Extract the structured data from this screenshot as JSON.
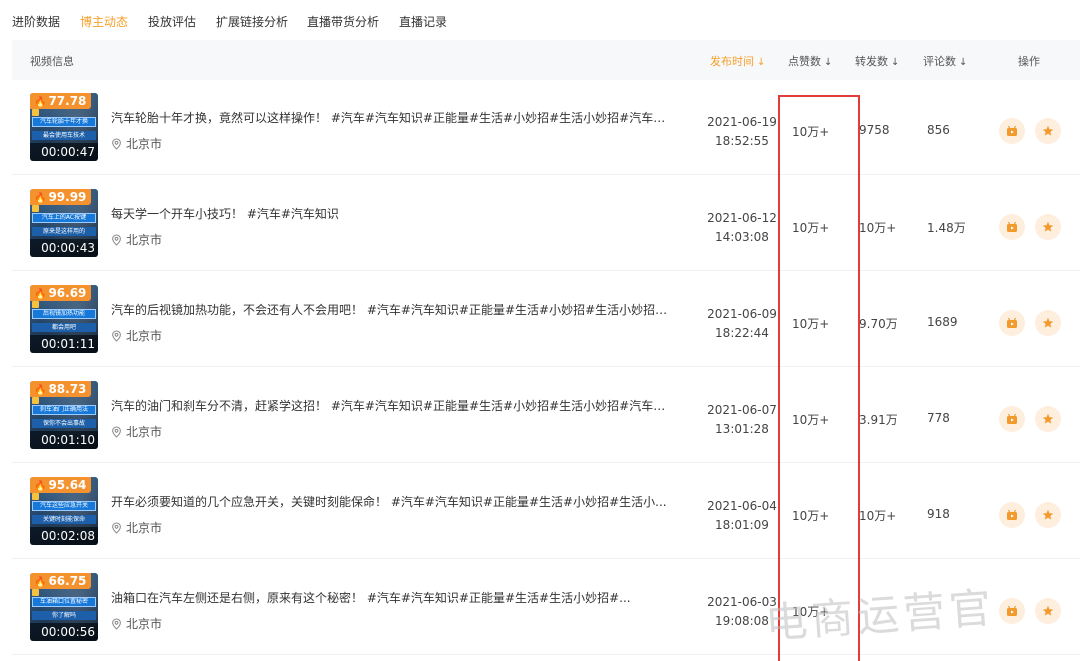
{
  "tabs": [
    "进阶数据",
    "博主动态",
    "投放评估",
    "扩展链接分析",
    "直播带货分析",
    "直播记录"
  ],
  "active_tab": "博主动态",
  "table": {
    "headers": {
      "video_info": "视频信息",
      "publish_time": "发布时间",
      "likes": "点赞数",
      "shares": "转发数",
      "comments": "评论数",
      "actions": "操作"
    },
    "rows": [
      {
        "score": "77.78",
        "duration": "00:00:47",
        "thumb_caption_1": "汽车轮胎十年才换",
        "thumb_caption_2": "最会使用车技术",
        "title": "汽车轮胎十年才换，竟然可以这样操作！ #汽车#汽车知识#正能量#生活#小妙招#生活小妙招#汽车故...",
        "location": "北京市",
        "date": "2021-06-19",
        "time": "18:52:55",
        "likes": "10万+",
        "shares": "9758",
        "comments": "856"
      },
      {
        "score": "99.99",
        "duration": "00:00:43",
        "thumb_caption_1": "汽车上的AC按键",
        "thumb_caption_2": "原来是这样用的",
        "title": "每天学一个开车小技巧！ #汽车#汽车知识",
        "location": "北京市",
        "date": "2021-06-12",
        "time": "14:03:08",
        "likes": "10万+",
        "shares": "10万+",
        "comments": "1.48万"
      },
      {
        "score": "96.69",
        "duration": "00:01:11",
        "thumb_caption_1": "后视镜加热功能",
        "thumb_caption_2": "都会用吧",
        "title": "汽车的后视镜加热功能，不会还有人不会用吧！ #汽车#汽车知识#正能量#生活#小妙招#生活小妙招#...",
        "location": "北京市",
        "date": "2021-06-09",
        "time": "18:22:44",
        "likes": "10万+",
        "shares": "9.70万",
        "comments": "1689"
      },
      {
        "score": "88.73",
        "duration": "00:01:10",
        "thumb_caption_1": "刹车油门正确用法",
        "thumb_caption_2": "保你不会出事故",
        "title": "汽车的油门和刹车分不清，赶紧学这招！ #汽车#汽车知识#正能量#生活#小妙招#生活小妙招#汽车故障",
        "location": "北京市",
        "date": "2021-06-07",
        "time": "13:01:28",
        "likes": "10万+",
        "shares": "3.91万",
        "comments": "778"
      },
      {
        "score": "95.64",
        "duration": "00:02:08",
        "thumb_caption_1": "汽车这些应急开关",
        "thumb_caption_2": "关键时刻能保命",
        "title": "开车必须要知道的几个应急开关，关键时刻能保命！ #汽车#汽车知识#正能量#生活#小妙招#生活小...",
        "location": "北京市",
        "date": "2021-06-04",
        "time": "18:01:09",
        "likes": "10万+",
        "shares": "10万+",
        "comments": "918"
      },
      {
        "score": "66.75",
        "duration": "00:00:56",
        "thumb_caption_1": "车油箱口位置秘密",
        "thumb_caption_2": "你了解吗",
        "title": "油箱口在汽车左侧还是右侧，原来有这个秘密！ #汽车#汽车知识#正能量#生活#生活小妙招#...",
        "location": "北京市",
        "date": "2021-06-03",
        "time": "19:08:08",
        "likes": "10万+",
        "shares": "",
        "comments": ""
      }
    ]
  },
  "watermark": "电商运营官",
  "colors": {
    "accent": "#f5a02a",
    "score_badge": "#f3922e",
    "highlight_box": "#e23b3b",
    "action_bg": "#fdeedd"
  },
  "icons": {
    "sort": "arrow-down-icon",
    "location": "location-pin-icon",
    "score": "flame-icon",
    "video_action": "video-icon",
    "favorite_action": "star-icon"
  }
}
